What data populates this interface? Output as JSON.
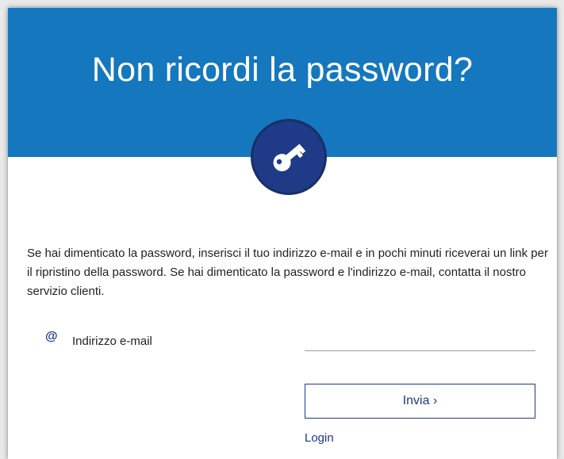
{
  "header": {
    "title": "Non ricordi la password?",
    "color": "#1577bd"
  },
  "badge": {
    "icon": "key-icon",
    "color": "#1f3a86"
  },
  "intro": {
    "text": "Se hai dimenticato la password, inserisci il tuo indirizzo e-mail e in pochi minuti riceverai un link per il ripristino della password. Se hai dimenticato la password e l'indirizzo e-mail, contatta il nostro servizio clienti."
  },
  "form": {
    "email_icon": "@",
    "email_label": "Indirizzo e-mail",
    "email_value": "",
    "submit_label": "Invia ›",
    "login_label": "Login"
  }
}
